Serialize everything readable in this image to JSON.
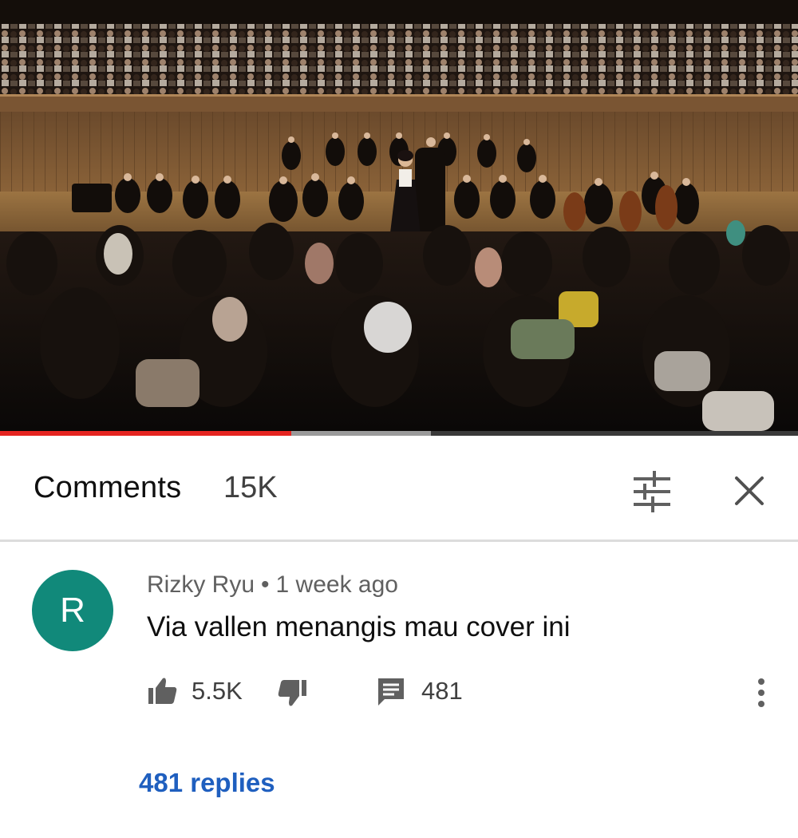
{
  "video": {
    "progress_played": 0.365,
    "progress_buffered": 0.54
  },
  "comments": {
    "title": "Comments",
    "count": "15K",
    "icons": {
      "filter": "sort-filter-icon",
      "close": "close-icon"
    }
  },
  "comment": {
    "avatar_letter": "R",
    "avatar_color": "#11897a",
    "author": "Rizky Ryu",
    "separator": "•",
    "time": "1 week ago",
    "text": "Via vallen menangis mau cover ini",
    "likes": "5.5K",
    "replies_count": "481",
    "replies_link": "481 replies",
    "icons": {
      "like": "thumbs-up-icon",
      "dislike": "thumbs-down-icon",
      "reply": "reply-icon",
      "more": "more-vert-icon"
    }
  },
  "colors": {
    "progress": "#e52420",
    "link": "#1f5fbf"
  }
}
